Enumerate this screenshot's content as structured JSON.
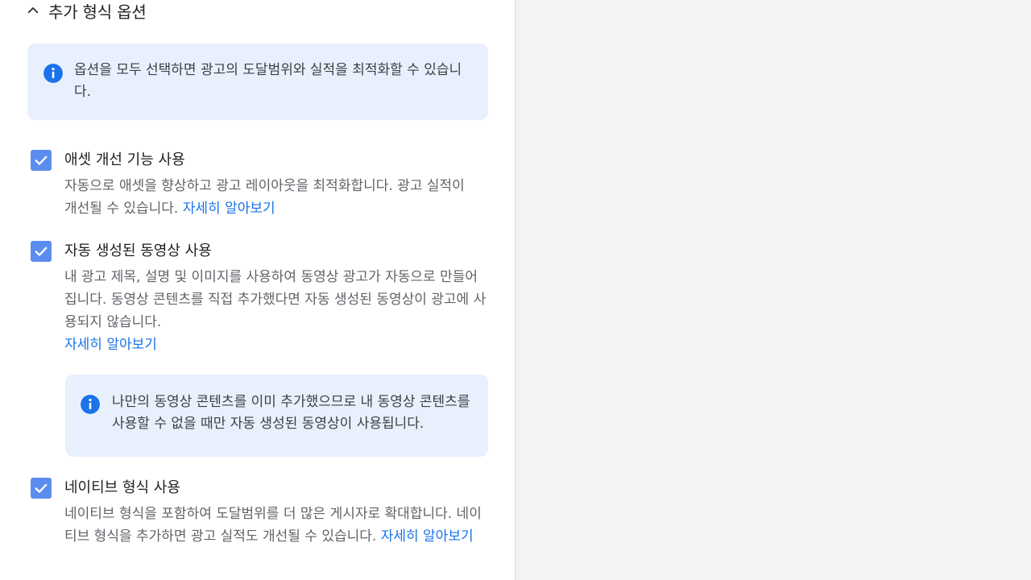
{
  "section": {
    "title": "추가 형식 옵션",
    "chevron_icon": "chevron-up-icon"
  },
  "info_top": {
    "icon": "info-icon",
    "text": "옵션을 모두 선택하면 광고의 도달범위와 실적을 최적화할 수 있습니다."
  },
  "options": [
    {
      "checked": true,
      "title": "애셋 개선 기능 사용",
      "description": "자동으로 애셋을 향상하고 광고 레이아웃을 최적화합니다. 광고 실적이 개선될 수 있습니다.",
      "link": "자세히 알아보기"
    },
    {
      "checked": true,
      "title": "자동 생성된 동영상 사용",
      "description": "내 광고 제목, 설명 및 이미지를 사용하여 동영상 광고가 자동으로 만들어집니다. 동영상 콘텐츠를 직접 추가했다면 자동 생성된 동영상이 광고에 사용되지 않습니다.",
      "link": "자세히 알아보기"
    },
    {
      "checked": true,
      "title": "네이티브 형식 사용",
      "description": "네이티브 형식을 포함하여 도달범위를 더 많은 게시자로 확대합니다. 네이티브 형식을 추가하면 광고 실적도 개선될 수 있습니다.",
      "link": "자세히 알아보기"
    }
  ],
  "info_video": {
    "icon": "info-icon",
    "text": "나만의 동영상 콘텐츠를 이미 추가했으므로 내 동영상 콘텐츠를 사용할 수 없을 때만 자동 생성된 동영상이 사용됩니다."
  },
  "colors": {
    "checkbox": "#5b8def",
    "info_bg": "#e8f0fe",
    "info_icon": "#1a73e8",
    "link": "#1a73e8",
    "right_bg": "#f1f3f4"
  }
}
